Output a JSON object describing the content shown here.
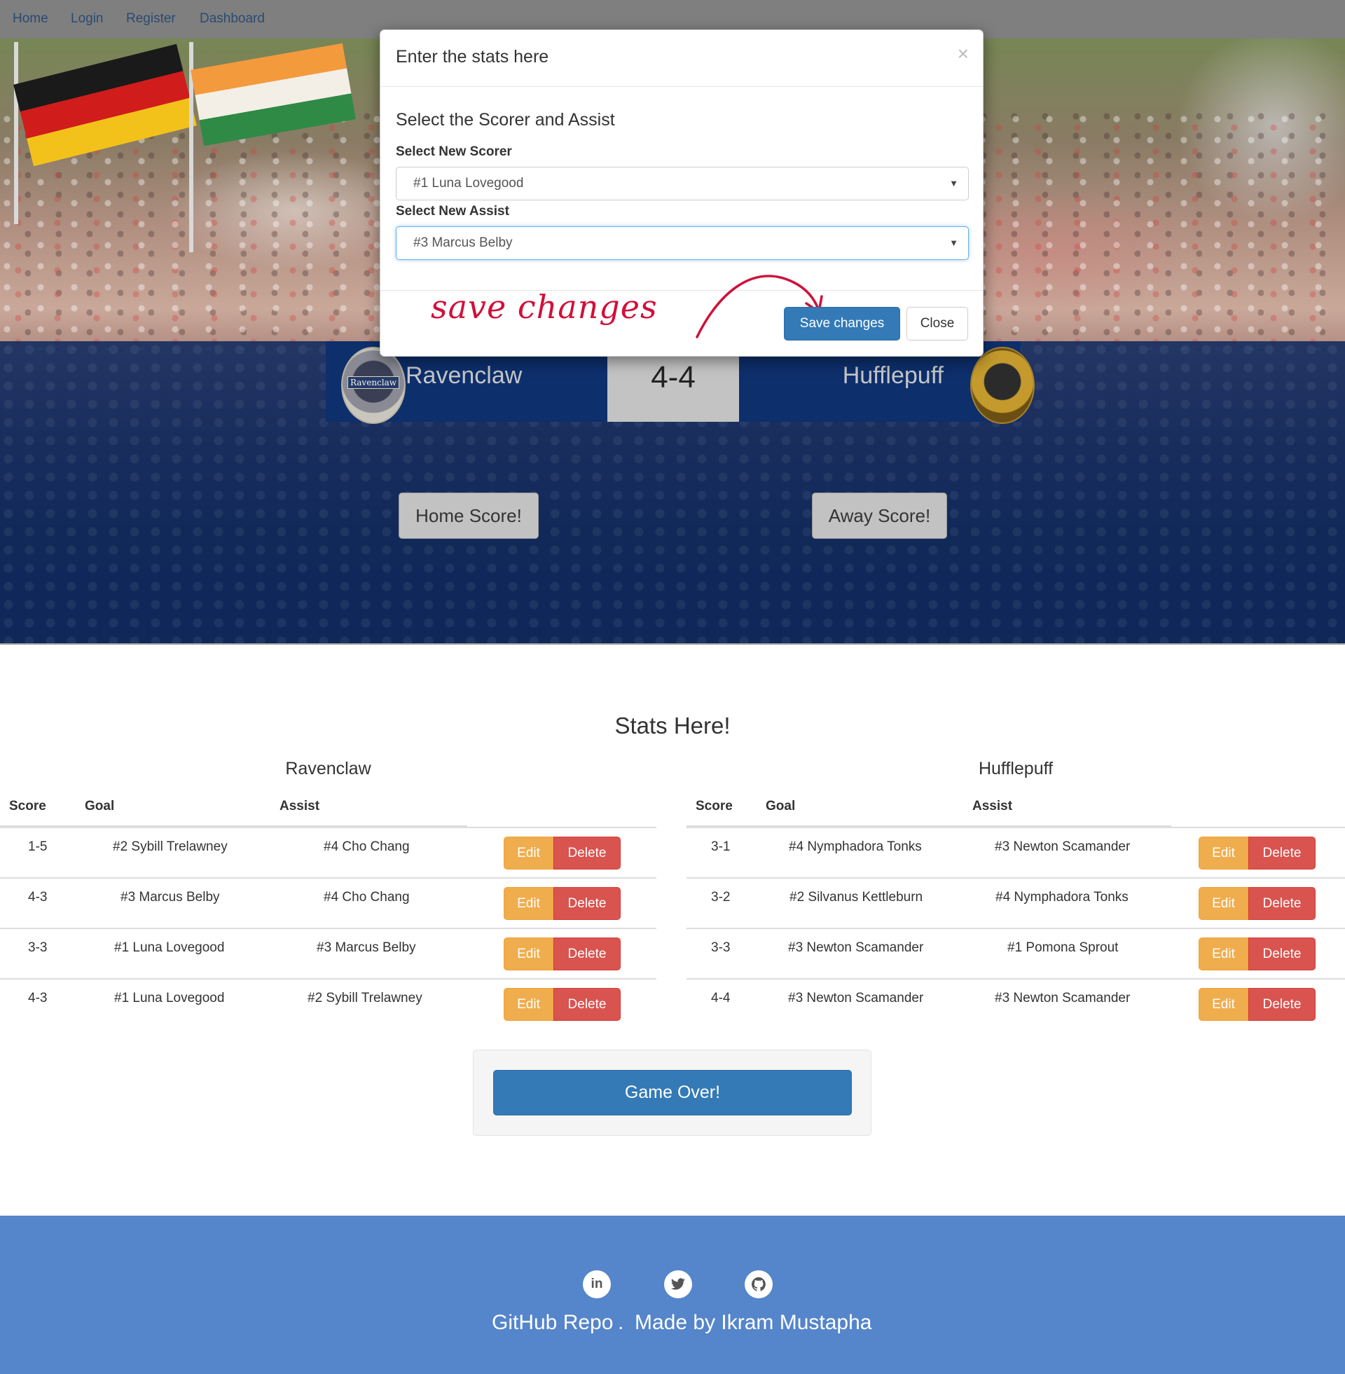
{
  "nav": {
    "items": [
      "Home",
      "Login",
      "Register",
      "Dashboard"
    ]
  },
  "modal": {
    "title": "Enter the stats here",
    "close_symbol": "×",
    "subtitle": "Select the Scorer and Assist",
    "scorer_label": "Select New Scorer",
    "scorer_value": "#1 Luna Lovegood",
    "assist_label": "Select New Assist",
    "assist_value": "#3 Marcus Belby",
    "save_label": "Save changes",
    "close_label": "Close",
    "annotation": "save changes"
  },
  "scoreboard": {
    "home_team": "Ravenclaw",
    "away_team": "Hufflepuff",
    "score": "4-4",
    "home_crest_text": "Ravenclaw",
    "home_score_btn": "Home Score!",
    "away_score_btn": "Away Score!"
  },
  "stats": {
    "title": "Stats Here!",
    "columns": [
      "Score",
      "Goal",
      "Assist"
    ],
    "edit_label": "Edit",
    "delete_label": "Delete",
    "home": {
      "team": "Ravenclaw",
      "rows": [
        {
          "score": "1-5",
          "goal": "#2 Sybill Trelawney",
          "assist": "#4 Cho Chang"
        },
        {
          "score": "4-3",
          "goal": "#3 Marcus Belby",
          "assist": "#4 Cho Chang"
        },
        {
          "score": "3-3",
          "goal": "#1 Luna Lovegood",
          "assist": "#3 Marcus Belby"
        },
        {
          "score": "4-3",
          "goal": "#1 Luna Lovegood",
          "assist": "#2 Sybill Trelawney"
        }
      ]
    },
    "away": {
      "team": "Hufflepuff",
      "rows": [
        {
          "score": "3-1",
          "goal": "#4 Nymphadora Tonks",
          "assist": "#3 Newton Scamander"
        },
        {
          "score": "3-2",
          "goal": "#2 Silvanus Kettleburn",
          "assist": "#4 Nymphadora Tonks"
        },
        {
          "score": "3-3",
          "goal": "#3 Newton Scamander",
          "assist": "#1 Pomona Sprout"
        },
        {
          "score": "4-4",
          "goal": "#3 Newton Scamander",
          "assist": "#3 Newton Scamander"
        }
      ]
    },
    "game_over": "Game Over!"
  },
  "footer": {
    "icons": [
      "linkedin-icon",
      "twitter-icon",
      "github-icon"
    ],
    "github_link": "GitHub Repo",
    "separator": ".",
    "credit": "Made by Ikram Mustapha"
  },
  "colors": {
    "primary": "#337ab7",
    "warning": "#f0ad4e",
    "danger": "#d9534f",
    "footer": "#5585ca",
    "annotation": "#d0103a"
  }
}
